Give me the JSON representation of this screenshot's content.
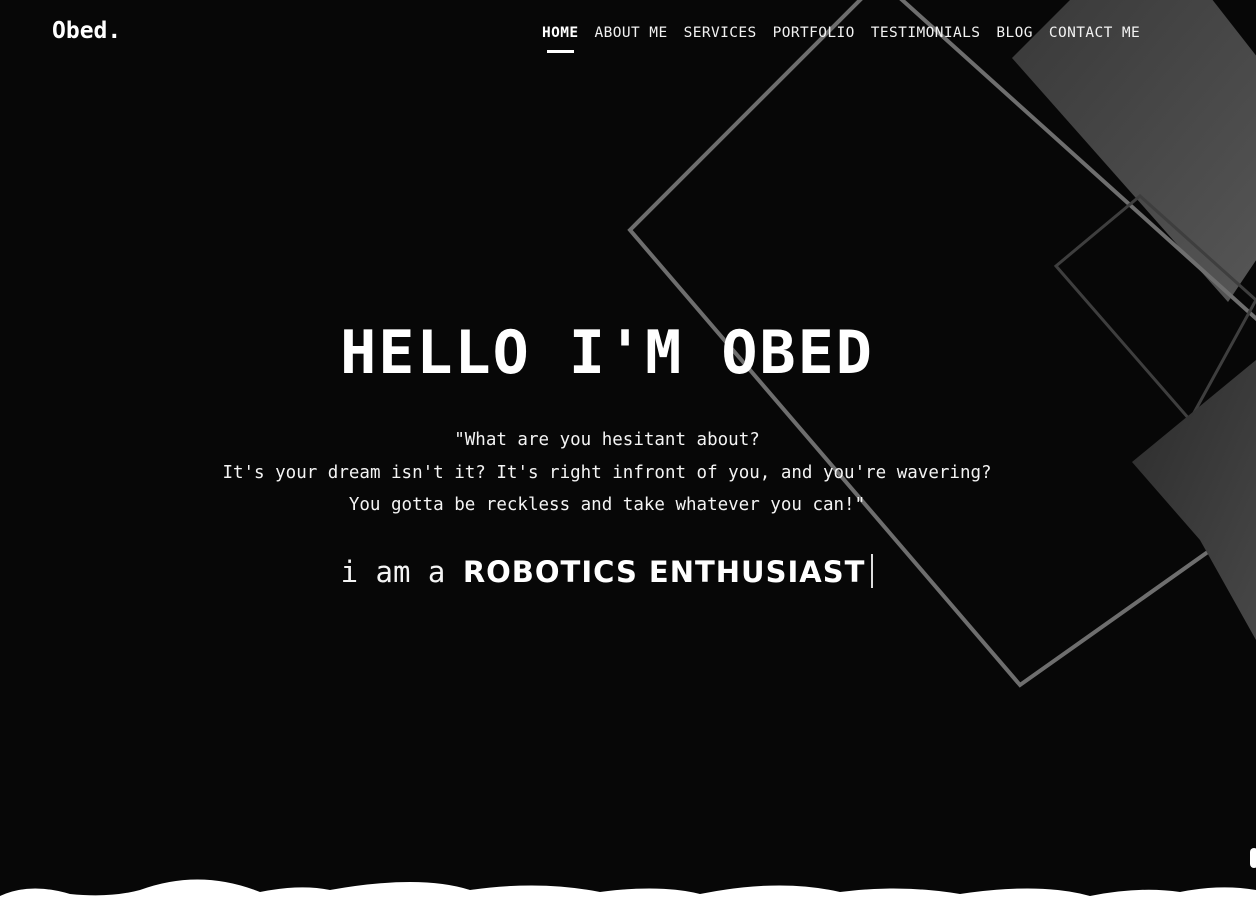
{
  "brand": {
    "logo": "Obed."
  },
  "nav": {
    "items": [
      {
        "label": "HOME",
        "active": true
      },
      {
        "label": "ABOUT ME",
        "active": false
      },
      {
        "label": "SERVICES",
        "active": false
      },
      {
        "label": "PORTFOLIO",
        "active": false
      },
      {
        "label": "TESTIMONIALS",
        "active": false
      },
      {
        "label": "BLOG",
        "active": false
      },
      {
        "label": "CONTACT ME",
        "active": false
      }
    ]
  },
  "hero": {
    "title": "HELLO I'M OBED",
    "quote_lines": [
      "\"What are you hesitant about?",
      "It's your dream isn't it? It's right infront of you, and you're wavering?",
      "You gotta be reckless and take whatever you can!\""
    ],
    "typing_prefix": "i am a",
    "typing_word": "ROBOTICS ENTHUSIAST"
  },
  "colors": {
    "background": "#070707",
    "text": "#ffffff",
    "shape_outline": "#6a6a6a",
    "shape_fill": "#4a4a4a",
    "clouds": "#ffffff"
  },
  "icons": {
    "caret": "typing-caret"
  }
}
